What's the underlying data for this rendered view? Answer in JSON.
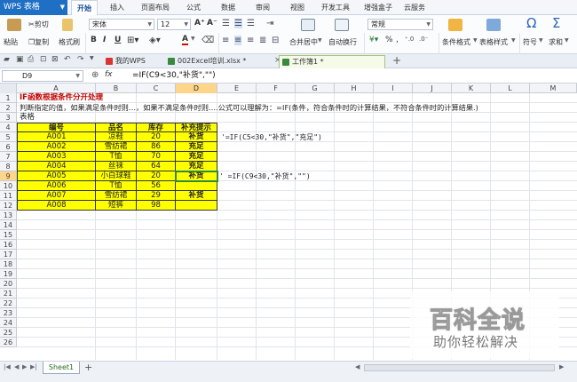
{
  "app": {
    "title": "WPS 表格"
  },
  "menu_tabs": [
    "开始",
    "插入",
    "页面布局",
    "公式",
    "数据",
    "审阅",
    "视图",
    "开发工具",
    "增强盒子",
    "云服务"
  ],
  "ribbon": {
    "paste": "粘贴",
    "cut": "剪切",
    "copy": "复制",
    "format_painter": "格式刷",
    "font_name": "宋体",
    "font_size": "12",
    "bold": "B",
    "italic": "I",
    "underline": "U",
    "font_color_letter": "A",
    "grow_font": "A⁺",
    "shrink_font": "A⁻",
    "merge_center": "合并居中",
    "wrap_text": "自动换行",
    "number_format": "常规",
    "percent": "%",
    "comma": ",",
    "cond_format": "条件格式",
    "table_style": "表格样式",
    "symbol": "符号",
    "sum": "求和",
    "omega": "Ω",
    "sigma": "Σ",
    "yen": "¥"
  },
  "doc_tabs": [
    "我的WPS",
    "002Excel培训.xlsx *",
    "工作簿1 *"
  ],
  "formula_bar": {
    "cell_ref": "D9",
    "fx": "fx",
    "formula": "=IF(C9<30,\"补货\",\"\")"
  },
  "columns": [
    "A",
    "B",
    "C",
    "D",
    "E",
    "F",
    "G",
    "H",
    "I",
    "J",
    "K",
    "L",
    "M"
  ],
  "rows": [
    "1",
    "2",
    "3",
    "4",
    "5",
    "6",
    "7",
    "8",
    "9",
    "10",
    "11",
    "12",
    "13",
    "14",
    "15",
    "16",
    "17",
    "18",
    "19",
    "20",
    "21",
    "22",
    "23",
    "24",
    "25",
    "26"
  ],
  "text_cells": {
    "r1": "IF函数根据条件分开处理",
    "r2": "判断指定的值，如果满足条件时则…，如果不满足条件时则….公式可以理解为：=IF(条件，符合条件时的计算结果，不符合条件时的计算结果.)",
    "r3": "表格",
    "e5": "'=IF(C5<30,\"补货\",\"充足\")",
    "e9": "' =IF(C9<30,\"补货\",\"\")"
  },
  "table": {
    "headers": [
      "编号",
      "品名",
      "库存",
      "补充提示"
    ],
    "rows": [
      [
        "A001",
        "凉鞋",
        "20",
        "补货"
      ],
      [
        "A002",
        "雪纺裙",
        "86",
        "充足"
      ],
      [
        "A003",
        "T恤",
        "70",
        "充足"
      ],
      [
        "A004",
        "丝袜",
        "64",
        "充足"
      ],
      [
        "A005",
        "小白球鞋",
        "20",
        "补货"
      ],
      [
        "A006",
        "T恤",
        "56",
        ""
      ],
      [
        "A007",
        "雪纺裙",
        "29",
        "补货"
      ],
      [
        "A008",
        "短裤",
        "98",
        ""
      ]
    ]
  },
  "sheet_tabs": [
    "Sheet1"
  ],
  "add_sheet": "+",
  "watermark": {
    "line1": "百科全说",
    "line2": "助你轻松解决"
  },
  "colors": {
    "yellow_fill": "#ffff00",
    "title_red": "#c00000",
    "brand_blue": "#1f6fc5",
    "active_green": "#2d8a3e"
  }
}
